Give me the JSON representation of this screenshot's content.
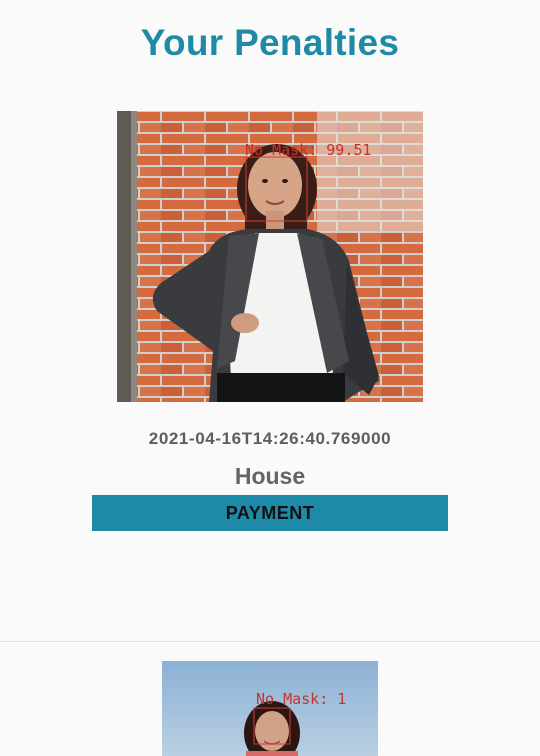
{
  "page": {
    "title": "Your Penalties"
  },
  "penalties": [
    {
      "detection_label": "No Mask: 99.51",
      "timestamp": "2021-04-16T14:26:40.769000",
      "location": "House",
      "payment_label": "PAYMENT"
    },
    {
      "detection_label": "No Mask: 1"
    }
  ],
  "colors": {
    "accent": "#1f8aa5",
    "button": "#1d8aa8",
    "detection": "#d63a3a"
  }
}
